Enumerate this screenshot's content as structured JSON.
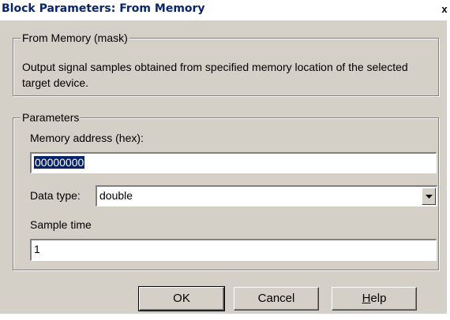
{
  "window": {
    "title": "Block Parameters: From Memory",
    "close_glyph": "x"
  },
  "mask_group": {
    "legend": "From Memory (mask)",
    "description": "Output signal samples obtained from specified memory location of the selected target device."
  },
  "params_group": {
    "legend": "Parameters",
    "memory_address_label": "Memory address (hex):",
    "memory_address_value": "00000000",
    "data_type_label": "Data type:",
    "data_type_value": "double",
    "sample_time_label": "Sample time",
    "sample_time_value": "1"
  },
  "buttons": {
    "ok": "OK",
    "cancel": "Cancel",
    "help_first": "H",
    "help_rest": "elp"
  },
  "icons": {
    "close": "close-icon",
    "dropdown": "chevron-down-icon"
  }
}
